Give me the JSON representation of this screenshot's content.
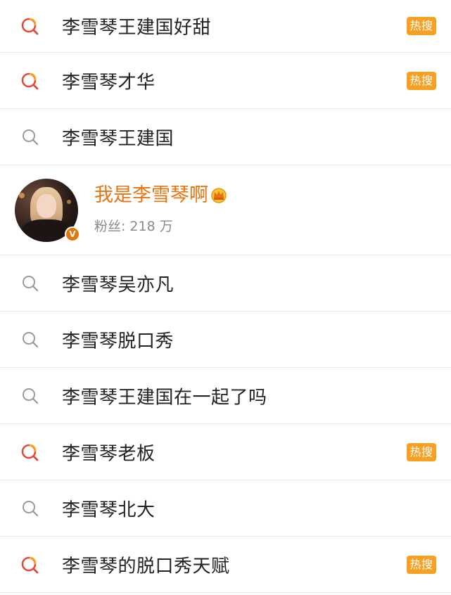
{
  "suggestions": [
    {
      "label": "李雪琴王建国好甜",
      "icon": "hot-search-icon",
      "badge": "热搜"
    },
    {
      "label": "李雪琴才华",
      "icon": "hot-search-icon",
      "badge": "热搜"
    },
    {
      "label": "李雪琴王建国",
      "icon": "search-icon",
      "badge": ""
    },
    {
      "label": "李雪琴吴亦凡",
      "icon": "search-icon",
      "badge": ""
    },
    {
      "label": "李雪琴脱口秀",
      "icon": "search-icon",
      "badge": ""
    },
    {
      "label": "李雪琴王建国在一起了吗",
      "icon": "search-icon",
      "badge": ""
    },
    {
      "label": "李雪琴老板",
      "icon": "hot-search-icon",
      "badge": "热搜"
    },
    {
      "label": "李雪琴北大",
      "icon": "search-icon",
      "badge": ""
    },
    {
      "label": "李雪琴的脱口秀天赋",
      "icon": "hot-search-icon",
      "badge": "热搜"
    }
  ],
  "user": {
    "name": "我是李雪琴啊",
    "fans_label": "粉丝:",
    "fans_count": "218 万",
    "verified_mark": "V",
    "icon": "crown-icon"
  },
  "colors": {
    "badge": "#f8a023",
    "username": "#e8730f",
    "hot_icon_ring": "#e24a3b",
    "hot_icon_accent": "#f6a623",
    "search_icon": "#9a9a9a",
    "divider": "#e6e6e6"
  }
}
